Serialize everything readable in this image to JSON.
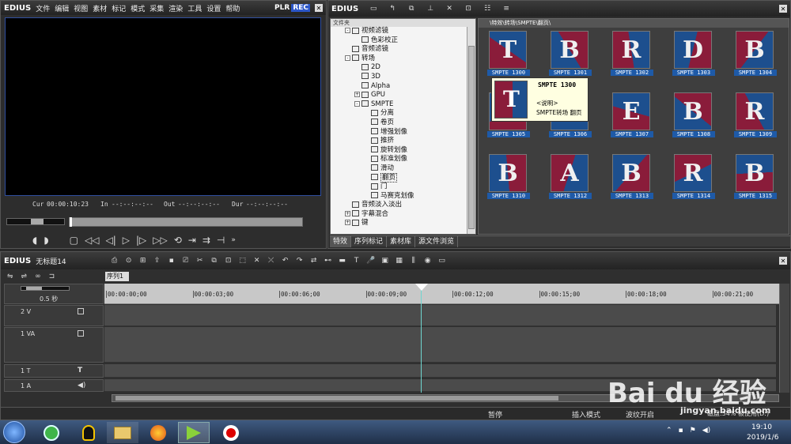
{
  "player": {
    "brand": "EDIUS",
    "menu": [
      "文件",
      "编辑",
      "视图",
      "素材",
      "标记",
      "模式",
      "采集",
      "渲染",
      "工具",
      "设置",
      "帮助"
    ],
    "plr": "PLR",
    "rec": "REC",
    "cur_label": "Cur",
    "cur_value": "00:00:10:23",
    "in_label": "In",
    "in_value": "--:--:--:--",
    "out_label": "Out",
    "out_value": "--:--:--:--",
    "dur_label": "Dur",
    "dur_value": "--:--:--:--"
  },
  "effects": {
    "brand": "EDIUS",
    "folder_header": "文件夹",
    "path": "\\特效\\转场\\SMPTE\\翻页\\",
    "tree": [
      {
        "label": "视频滤镜",
        "indent": 0,
        "exp": "-"
      },
      {
        "label": "色彩校正",
        "indent": 1,
        "exp": ""
      },
      {
        "label": "音频滤镜",
        "indent": 0,
        "exp": ""
      },
      {
        "label": "转场",
        "indent": 0,
        "exp": "-"
      },
      {
        "label": "2D",
        "indent": 1,
        "exp": ""
      },
      {
        "label": "3D",
        "indent": 1,
        "exp": ""
      },
      {
        "label": "Alpha",
        "indent": 1,
        "exp": ""
      },
      {
        "label": "GPU",
        "indent": 1,
        "exp": "+"
      },
      {
        "label": "SMPTE",
        "indent": 1,
        "exp": "-"
      },
      {
        "label": "分离",
        "indent": 2,
        "exp": ""
      },
      {
        "label": "卷页",
        "indent": 2,
        "exp": ""
      },
      {
        "label": "增强划像",
        "indent": 2,
        "exp": ""
      },
      {
        "label": "推挤",
        "indent": 2,
        "exp": ""
      },
      {
        "label": "旋转划像",
        "indent": 2,
        "exp": ""
      },
      {
        "label": "标准划像",
        "indent": 2,
        "exp": ""
      },
      {
        "label": "滑动",
        "indent": 2,
        "exp": ""
      },
      {
        "label": "翻页",
        "indent": 2,
        "exp": "",
        "selected": true
      },
      {
        "label": "门",
        "indent": 2,
        "exp": ""
      },
      {
        "label": "马赛克划像",
        "indent": 2,
        "exp": ""
      },
      {
        "label": "音频淡入淡出",
        "indent": 0,
        "exp": ""
      },
      {
        "label": "字幕混合",
        "indent": 0,
        "exp": "+"
      },
      {
        "label": "键",
        "indent": 0,
        "exp": "+"
      }
    ],
    "tabs": [
      "特效",
      "序列标记",
      "素材库",
      "源文件浏览"
    ],
    "thumbs": [
      {
        "label": "SMPTE 1300",
        "glyph": "T"
      },
      {
        "label": "SMPTE 1301",
        "glyph": "B"
      },
      {
        "label": "SMPTE 1302",
        "glyph": "R"
      },
      {
        "label": "SMPTE 1303",
        "glyph": "D"
      },
      {
        "label": "SMPTE 1304",
        "glyph": "B"
      },
      {
        "label": "SMPTE 1305",
        "glyph": "B"
      },
      {
        "label": "SMPTE 1306",
        "glyph": "B"
      },
      {
        "label": "SMPTE 1307",
        "glyph": "E"
      },
      {
        "label": "SMPTE 1308",
        "glyph": "B"
      },
      {
        "label": "SMPTE 1309",
        "glyph": "R"
      },
      {
        "label": "SMPTE 1310",
        "glyph": "B"
      },
      {
        "label": "SMPTE 1312",
        "glyph": "A"
      },
      {
        "label": "SMPTE 1313",
        "glyph": "B"
      },
      {
        "label": "SMPTE 1314",
        "glyph": "R"
      },
      {
        "label": "SMPTE 1315",
        "glyph": "B"
      }
    ],
    "tooltip": {
      "title": "SMPTE 1300",
      "desc_label": "<说明>",
      "desc": "SMPTE转场 翻页"
    }
  },
  "timeline": {
    "brand": "EDIUS",
    "project": "无标题14",
    "sequence_tab": "序列1",
    "zoom": "0.5 秒",
    "ruler": [
      "00:00:00;00",
      "00:00:03;00",
      "00:00:06;00",
      "00:00:09;00",
      "00:00:12;00",
      "00:00:15;00",
      "00:00:18;00",
      "00:00:21;00"
    ],
    "tracks": [
      {
        "name": "2 V"
      },
      {
        "name": "1 VA"
      },
      {
        "name": "1 T"
      },
      {
        "name": "1 A"
      }
    ],
    "status": {
      "state": "暂停",
      "insert_mode": "插入模式",
      "ripple": "波纹开启",
      "disk": "磁盘:54% 被使用(D:)"
    }
  },
  "taskbar": {
    "time": "19:10",
    "date": "2019/1/6"
  },
  "watermark": {
    "text": "Bai du 经验",
    "url": "jingyan.baidu.com"
  }
}
